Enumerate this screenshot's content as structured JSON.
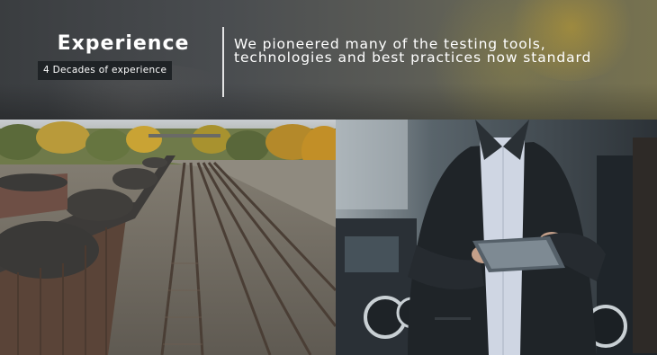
{
  "header": {
    "title": "Experience",
    "badge": "4 Decades of experience",
    "tagline_line1": "We pioneered many of the testing tools,",
    "tagline_line2": "technologies and best practices now standard"
  },
  "images": {
    "left": "rail-yard-coal-train-image",
    "right": "technician-with-tablet-image"
  }
}
